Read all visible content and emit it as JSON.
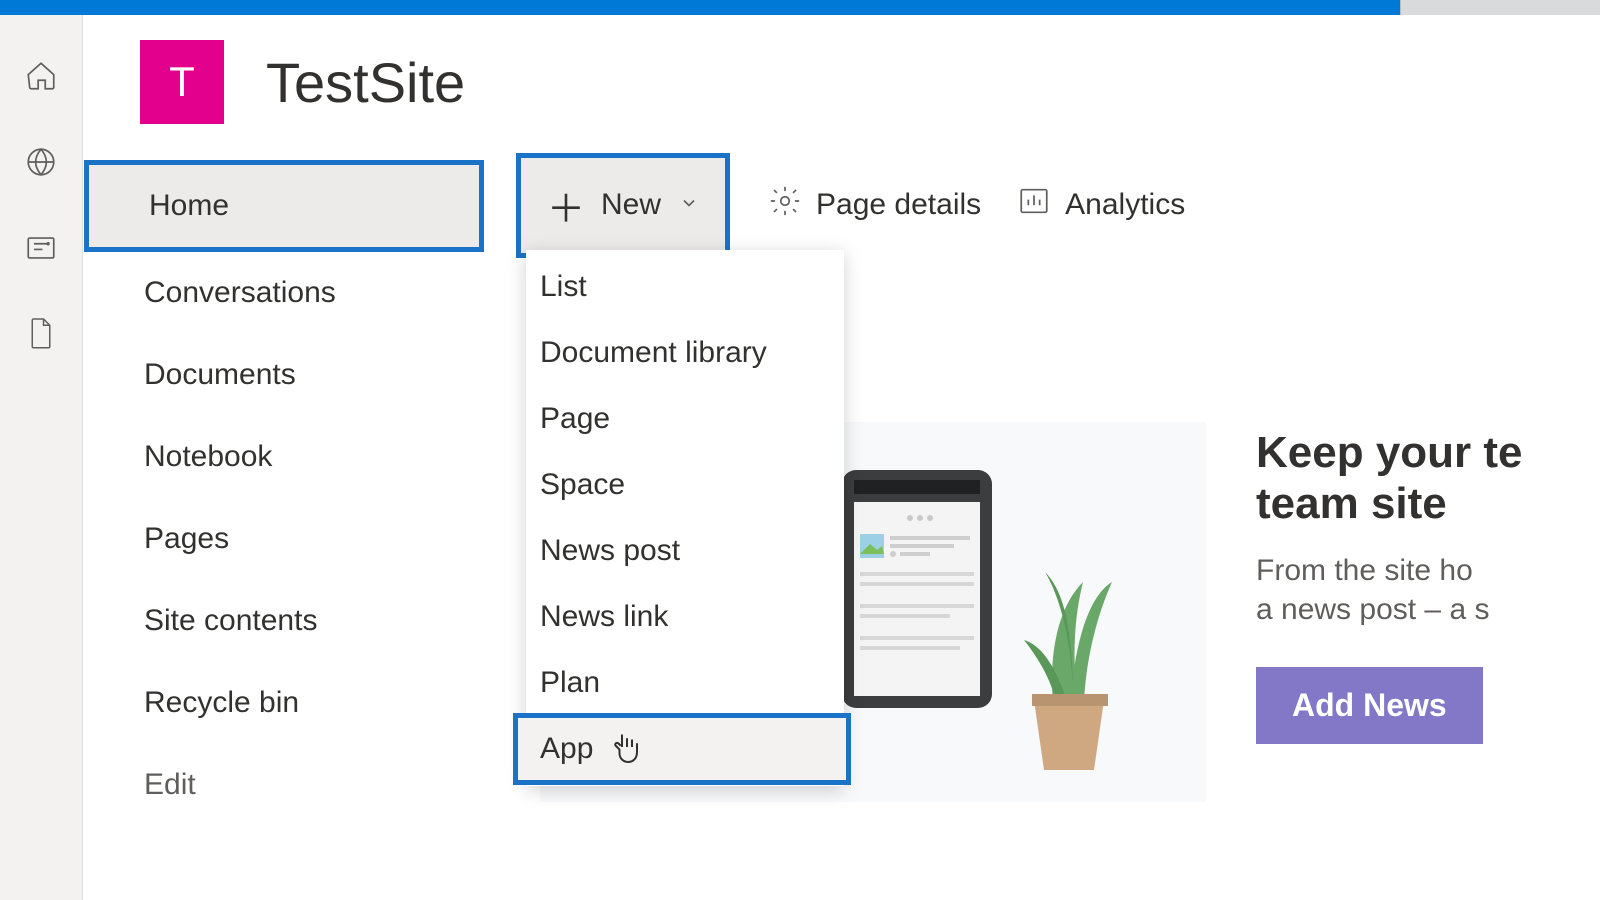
{
  "site": {
    "logo_letter": "T",
    "title": "TestSite"
  },
  "nav": {
    "items": [
      "Home",
      "Conversations",
      "Documents",
      "Notebook",
      "Pages",
      "Site contents",
      "Recycle bin"
    ],
    "edit": "Edit",
    "selected_index": 0
  },
  "toolbar": {
    "new_label": "New",
    "page_details": "Page details",
    "analytics": "Analytics"
  },
  "new_dropdown": {
    "items": [
      "List",
      "Document library",
      "Page",
      "Space",
      "News post",
      "News link",
      "Plan",
      "App"
    ],
    "highlighted_index": 7
  },
  "promo": {
    "heading_line1": "Keep your te",
    "heading_line2": "team site",
    "body_line1": "From the site ho",
    "body_line2": "a news post – a s",
    "button": "Add News"
  }
}
